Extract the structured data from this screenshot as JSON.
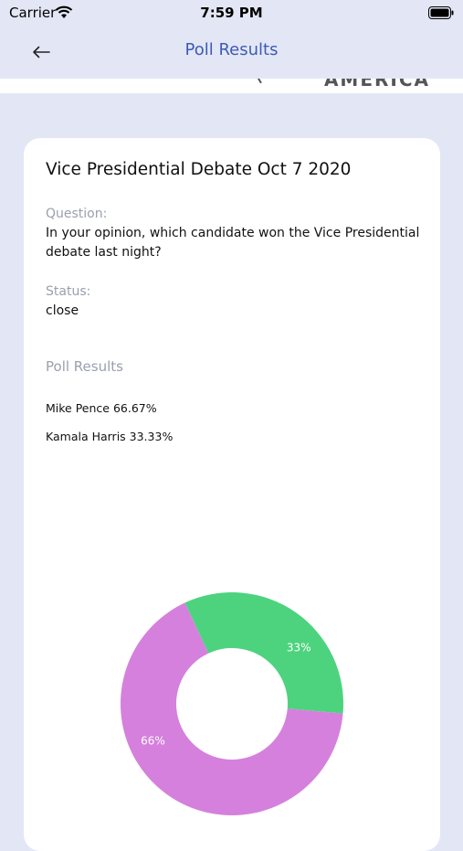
{
  "status_bar": {
    "carrier": "Carrier",
    "time": "7:59 PM"
  },
  "nav": {
    "title": "Poll Results",
    "back_icon": "arrow-left-icon"
  },
  "banner": {
    "fragment": "AMERICA"
  },
  "poll": {
    "title": "Vice Presidential Debate Oct 7 2020",
    "question_label": "Question:",
    "question": "In your opinion, which candidate won the Vice Presidential debate last night?",
    "status_label": "Status:",
    "status": "close",
    "results_label": "Poll Results",
    "results": [
      {
        "text": "Mike Pence 66.67%"
      },
      {
        "text": "Kamala Harris 33.33%"
      }
    ]
  },
  "chart_data": {
    "type": "pie",
    "donut": true,
    "slices": [
      {
        "label": "Mike Pence",
        "value": 66.67,
        "display": "66%",
        "color": "#d580dd"
      },
      {
        "label": "Kamala Harris",
        "value": 33.33,
        "display": "33%",
        "color": "#4dd37e"
      }
    ],
    "start_angle_deg": -25,
    "title": ""
  },
  "colors": {
    "background": "#e3e7f5",
    "nav_title": "#3d5bb5",
    "card": "#ffffff",
    "label": "#9aa0ad"
  }
}
